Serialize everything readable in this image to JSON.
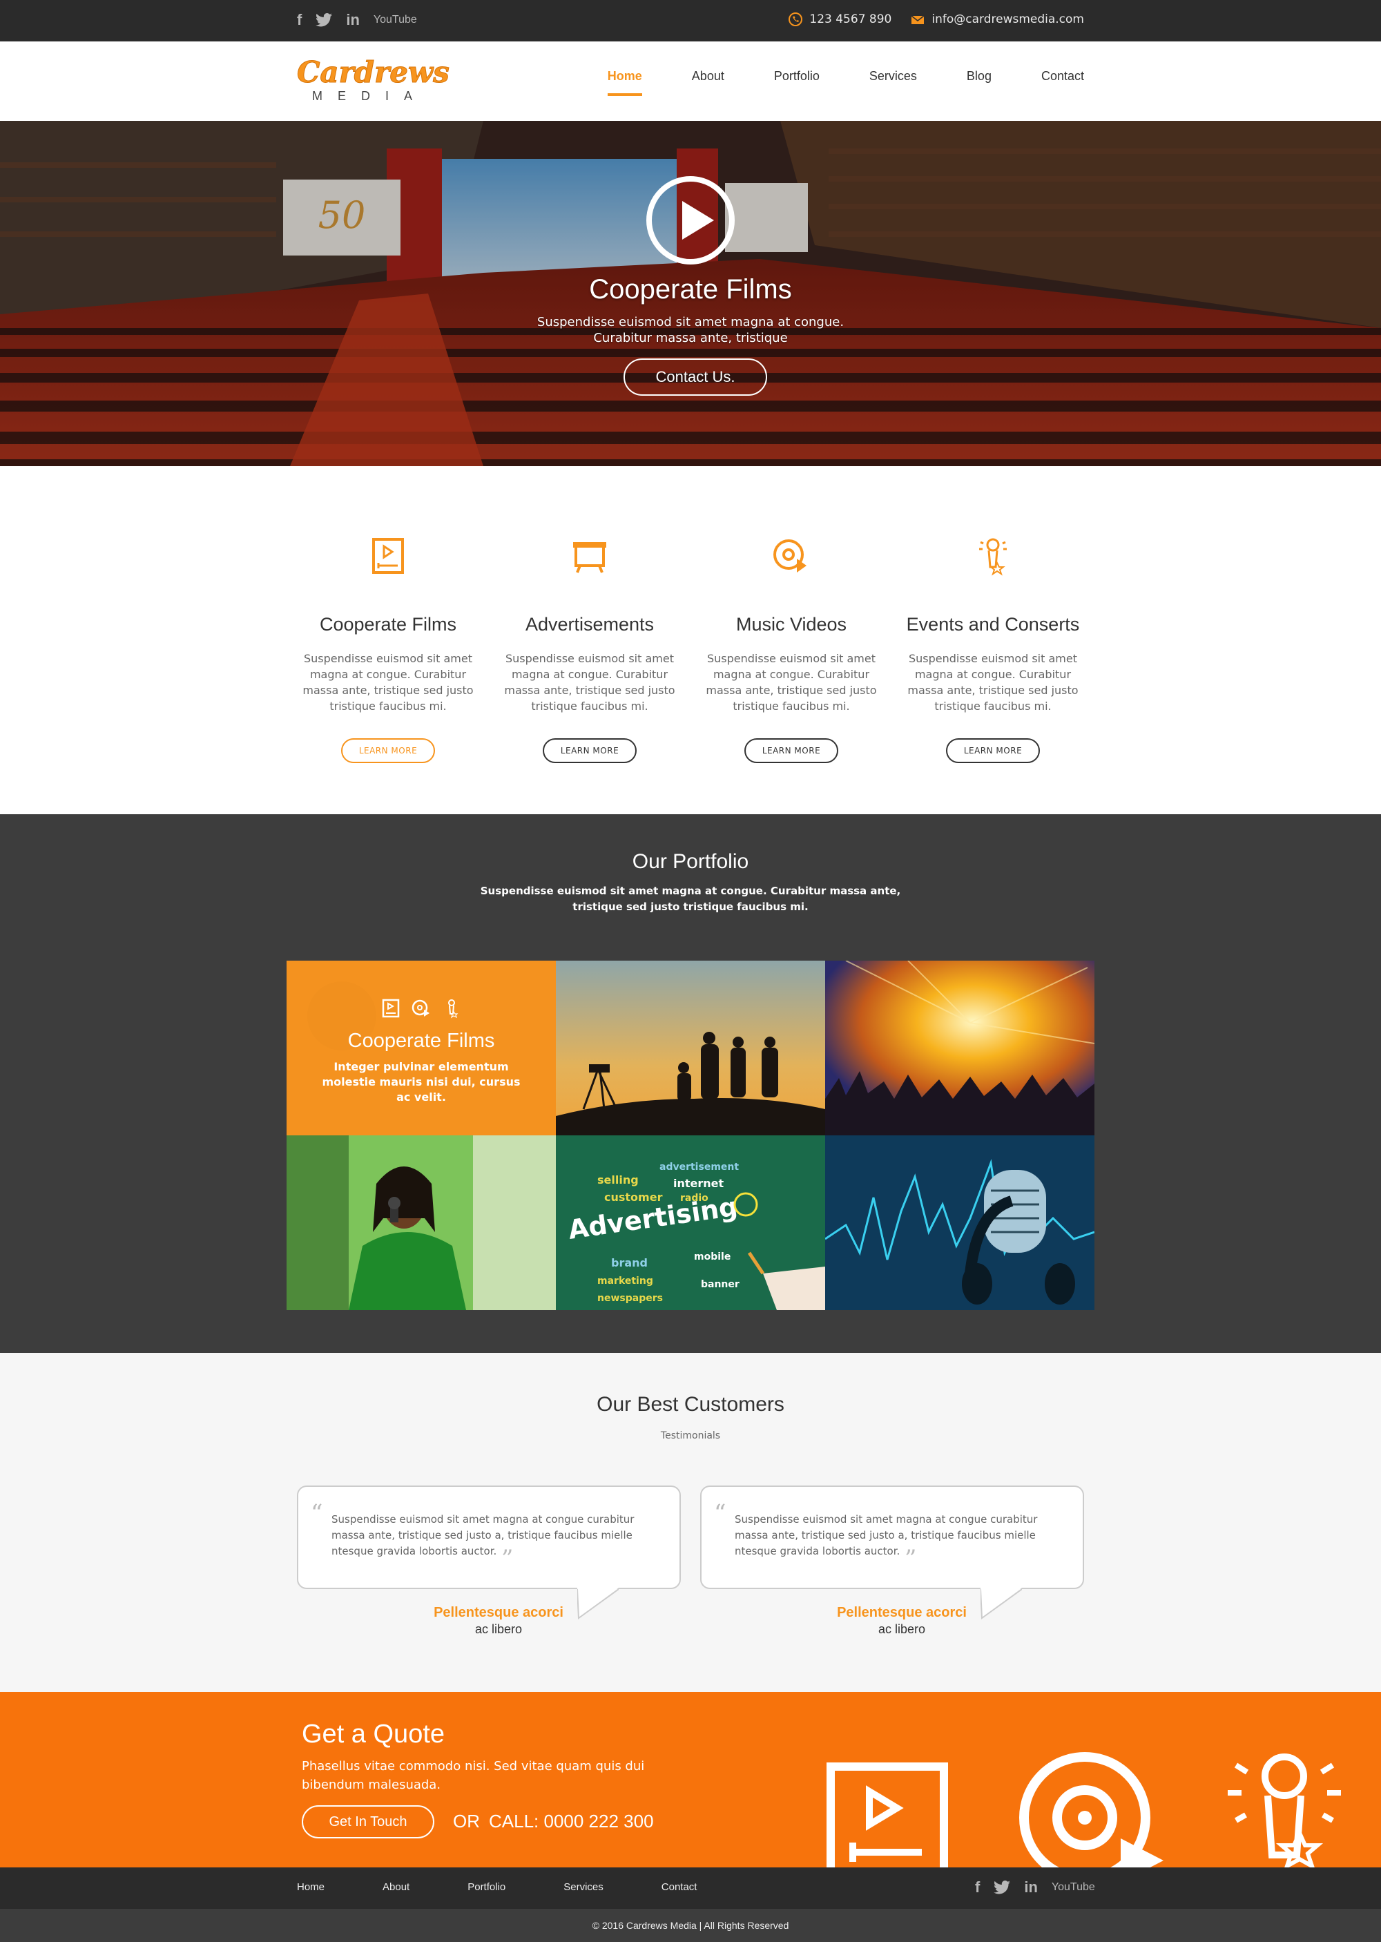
{
  "topbar": {
    "social": [
      "f",
      "t",
      "in",
      "YouTube"
    ],
    "phone": "123 4567 890",
    "email": "info@cardrewsmedia.com"
  },
  "brand": {
    "name": "Cardrews",
    "tagline": "MEDIA"
  },
  "nav": {
    "items": [
      {
        "label": "Home"
      },
      {
        "label": "About"
      },
      {
        "label": "Portfolio"
      },
      {
        "label": "Services"
      },
      {
        "label": "Blog"
      },
      {
        "label": "Contact"
      }
    ],
    "active": "Home"
  },
  "hero": {
    "title": "Cooperate Films",
    "subtitle": "Suspendisse euismod sit amet magna at congue. Curabitur massa ante, tristique",
    "button": "Contact Us."
  },
  "services": {
    "items": [
      {
        "icon": "film-icon",
        "title": "Cooperate Films",
        "text": "Suspendisse euismod sit amet magna at congue. Curabitur massa ante, tristique sed justo tristique faucibus mi.",
        "button": "LEARN MORE"
      },
      {
        "icon": "tv-icon",
        "title": "Advertisements",
        "text": "Suspendisse euismod sit amet magna at congue. Curabitur massa ante, tristique sed justo tristique faucibus mi.",
        "button": "LEARN MORE"
      },
      {
        "icon": "disc-play-icon",
        "title": "Music Videos",
        "text": "Suspendisse euismod sit amet magna at congue. Curabitur massa ante, tristique sed justo tristique faucibus mi.",
        "button": "LEARN MORE"
      },
      {
        "icon": "microphone-star-icon",
        "title": "Events and Conserts",
        "text": "Suspendisse euismod sit amet magna at congue. Curabitur massa ante, tristique sed justo tristique faucibus mi.",
        "button": "LEARN MORE"
      }
    ]
  },
  "portfolio": {
    "title": "Our Portfolio",
    "subtitle": "Suspendisse euismod sit amet magna at congue. Curabitur massa ante, tristique sed justo tristique faucibus mi.",
    "overlay": {
      "title": "Cooperate Films",
      "text": "Integer pulvinar elementum molestie mauris nisi dui, cursus ac velit."
    },
    "tiles": [
      "film-crew-silhouette",
      "concert-crowd",
      "singer-green-jacket",
      "advertising-chalkboard",
      "microphone-soundwave"
    ]
  },
  "customers": {
    "title": "Our Best Customers",
    "label": "Testimonials",
    "testimonials": [
      {
        "text": "Suspendisse euismod sit amet magna at congue curabitur massa ante, tristique sed justo a, tristique faucibus mielle ntesque gravida lobortis auctor.",
        "name": "Pellentesque acorci",
        "role": "ac libero"
      },
      {
        "text": "Suspendisse euismod sit amet magna at congue curabitur massa ante, tristique sed justo a, tristique faucibus mielle ntesque gravida lobortis auctor.",
        "name": "Pellentesque acorci",
        "role": "ac libero"
      }
    ]
  },
  "quote": {
    "title": "Get a Quote",
    "text": "Phasellus vitae commodo nisi. Sed vitae quam quis dui bibendum malesuada.",
    "button": "Get In Touch",
    "or": "OR",
    "call": "CALL: 0000 222 300"
  },
  "footer": {
    "nav": [
      "Home",
      "About",
      "Portfolio",
      "Services",
      "Contact"
    ],
    "copyright": "© 2016 Cardrews Media   |   All Rights Reserved"
  },
  "colors": {
    "accent": "#f7941d",
    "band": "#f7730c",
    "dark": "#2b2b2b",
    "portfolio_bg": "#3d3d3d"
  }
}
